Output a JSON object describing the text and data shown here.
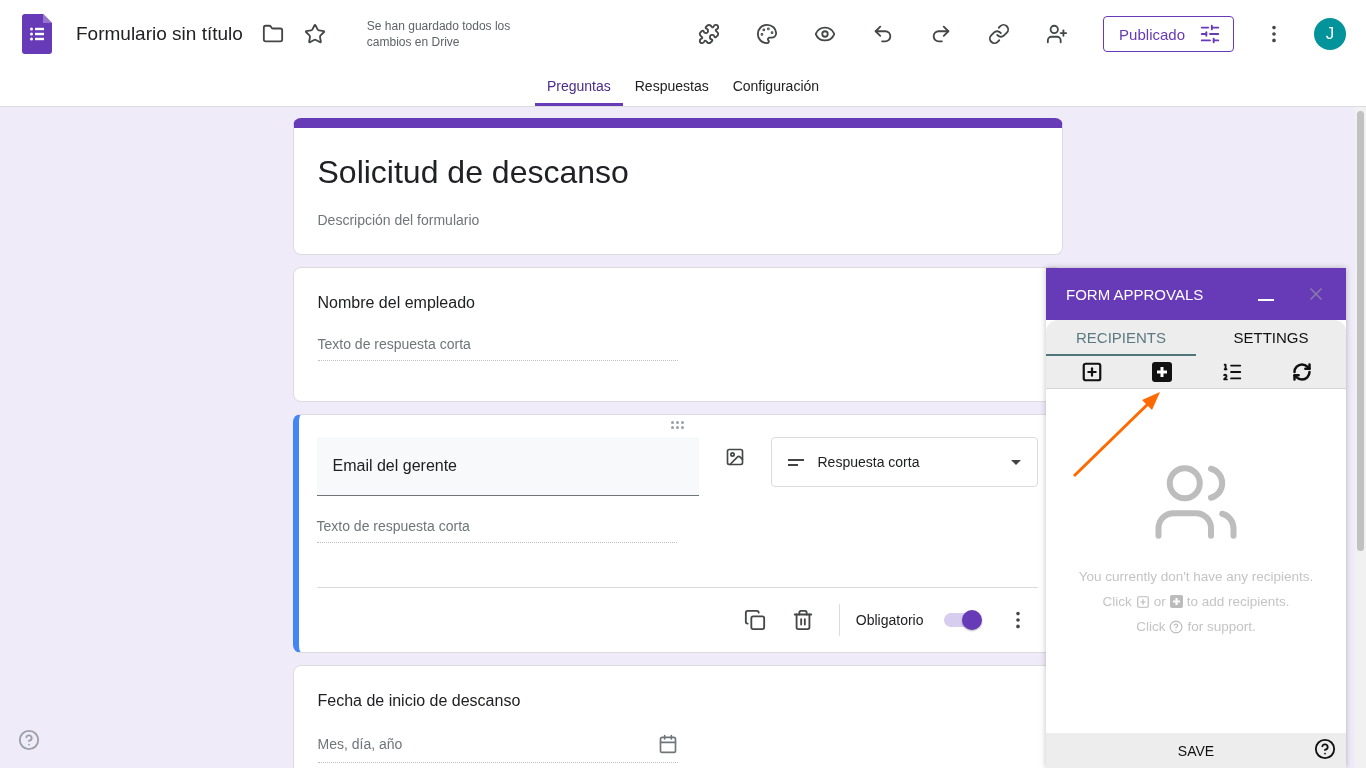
{
  "header": {
    "doc_title": "Formulario sin título",
    "save_status": "Se han guardado todos los cambios en Drive",
    "publish_button": "Publicado",
    "avatar_letter": "J"
  },
  "tabs": [
    {
      "label": "Preguntas",
      "selected": true
    },
    {
      "label": "Respuestas",
      "selected": false
    },
    {
      "label": "Configuración",
      "selected": false
    }
  ],
  "form": {
    "title": "Solicitud de descanso",
    "description": "Descripción del formulario"
  },
  "questions": [
    {
      "kind": "short",
      "title": "Nombre del empleado",
      "answer_hint": "Texto de respuesta corta",
      "active": false
    },
    {
      "kind": "short",
      "title": "Email del gerente",
      "answer_hint": "Texto de respuesta corta",
      "active": true,
      "type_label": "Respuesta corta",
      "required_label": "Obligatorio",
      "required": true
    },
    {
      "kind": "date",
      "title": "Fecha de inicio de descanso",
      "answer_hint": "Mes, día, año",
      "active": false
    }
  ],
  "panel": {
    "title": "FORM APPROVALS",
    "tabs": [
      {
        "label": "RECIPIENTS",
        "selected": true
      },
      {
        "label": "SETTINGS",
        "selected": false
      }
    ],
    "empty_line_1": "You currently don't have any recipients.",
    "empty_line_2": [
      "Click",
      "or",
      "to add recipients."
    ],
    "empty_line_3": [
      "Click",
      "for support."
    ],
    "save_button": "SAVE"
  }
}
